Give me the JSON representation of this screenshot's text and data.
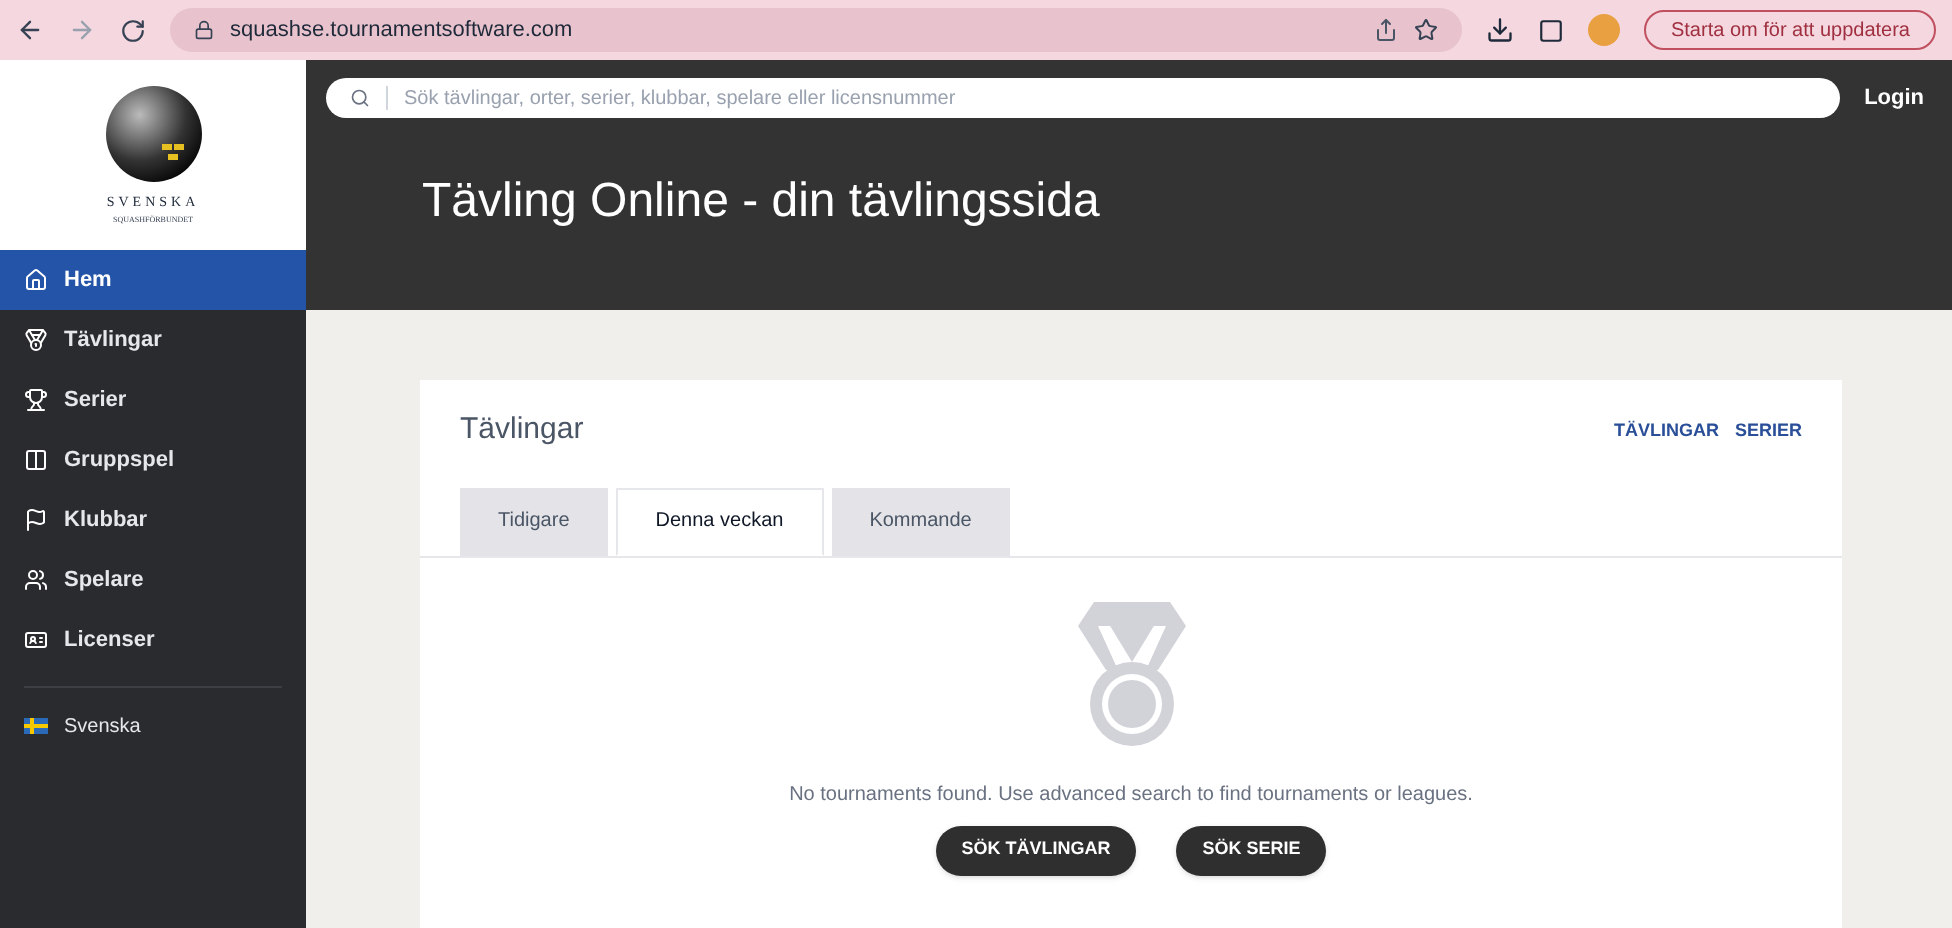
{
  "browser": {
    "url": "squashse.tournamentsoftware.com",
    "update_button": "Starta om för att uppdatera"
  },
  "logo": {
    "title": "SVENSKA",
    "subtitle": "SQUASHFÖRBUNDET"
  },
  "sidebar": {
    "items": [
      {
        "label": "Hem",
        "selected": true
      },
      {
        "label": "Tävlingar",
        "selected": false
      },
      {
        "label": "Serier",
        "selected": false
      },
      {
        "label": "Gruppspel",
        "selected": false
      },
      {
        "label": "Klubbar",
        "selected": false
      },
      {
        "label": "Spelare",
        "selected": false
      },
      {
        "label": "Licenser",
        "selected": false
      }
    ],
    "language": "Svenska"
  },
  "header": {
    "search_placeholder": "Sök tävlingar, orter, serier, klubbar, spelare eller licensnummer",
    "login": "Login",
    "title": "Tävling Online - din tävlingssida"
  },
  "card": {
    "title": "Tävlingar",
    "links": [
      "TÄVLINGAR",
      "SERIER"
    ],
    "tabs": [
      {
        "label": "Tidigare",
        "selected": false
      },
      {
        "label": "Denna veckan",
        "selected": true
      },
      {
        "label": "Kommande",
        "selected": false
      }
    ],
    "empty_message": "No tournaments found. Use advanced search to find tournaments or leagues.",
    "buttons": [
      "SÖK TÄVLINGAR",
      "SÖK SERIE"
    ]
  }
}
